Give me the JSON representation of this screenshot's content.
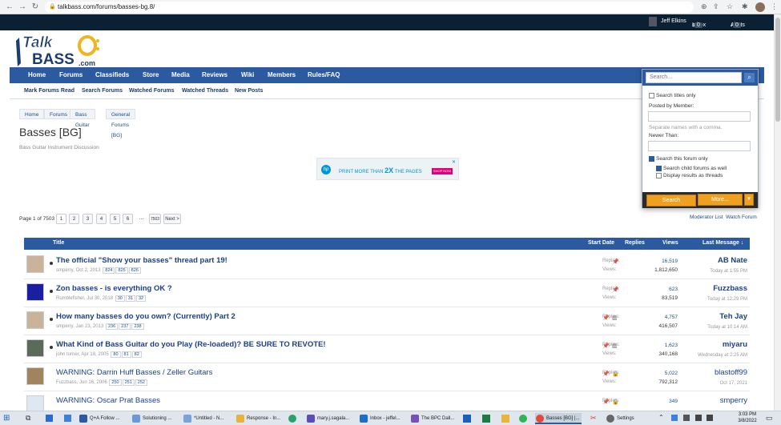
{
  "browser": {
    "url": "talkbass.com/forums/basses-bg.8/"
  },
  "userbar": {
    "user_name": "Jeff Elkins",
    "inbox_label": "Inbox",
    "inbox_count": "0",
    "alerts_label": "Alerts",
    "alerts_count": "0"
  },
  "logo": {
    "line1": "Talk",
    "line2": "BASS",
    "suffix": ".com"
  },
  "main_nav": [
    "Home",
    "Forums",
    "Classifieds",
    "Store",
    "Media",
    "Reviews",
    "Wiki",
    "Members",
    "Rules/FAQ"
  ],
  "sub_nav": [
    "Mark Forums Read",
    "Search Forums",
    "Watched Forums",
    "Watched Threads",
    "New Posts"
  ],
  "breadcrumb": [
    "Home",
    "Forums",
    "Bass Guitar",
    "General Forums [BG]"
  ],
  "page": {
    "title": "Basses [BG]",
    "subtitle": "Bass Guitar Instrument Discussion"
  },
  "ad": {
    "text_pre": "PRINT MORE THAN ",
    "text_big": "2X",
    "text_post": " THE PAGES",
    "button": "SHOP NOW"
  },
  "pager": {
    "label": "Page 1 of 7503",
    "pages": [
      "1",
      "2",
      "3",
      "4",
      "5",
      "6"
    ],
    "ellipsis": "…",
    "last": "7503",
    "next": "Next >"
  },
  "search_panel": {
    "placeholder": "Search...",
    "titles_only": "Search titles only",
    "posted_by": "Posted by Member:",
    "names_hint": "Separate names with a comma.",
    "newer_than": "Newer Than:",
    "this_forum_only": "Search this forum only",
    "child_forums": "Search child forums as well",
    "as_threads": "Display results as threads",
    "search_button": "Search",
    "more_button": "More..."
  },
  "mod_links": {
    "moderator_list": "Moderator List",
    "watch_forum": "Watch Forum"
  },
  "table": {
    "headers": {
      "title": "Title",
      "start_date": "Start Date",
      "replies": "Replies",
      "views": "Views",
      "last_message": "Last Message ↓"
    },
    "replies_label": "Replies:",
    "views_label": "Views:",
    "rows": [
      {
        "title": "The official \"Show your basses\" thread part 19!",
        "author": "smperry",
        "date": "Oct 2, 2013",
        "pages": [
          "824",
          "825",
          "826"
        ],
        "replies": "16,519",
        "views": "1,812,650",
        "last_user": "AB Nate",
        "last_time": "Today at 1:55 PM"
      },
      {
        "title": "Zon basses - is everything OK ?",
        "author": "Rumblefisher",
        "date": "Jul 30, 2018",
        "pages": [
          "30",
          "31",
          "32"
        ],
        "replies": "623",
        "views": "83,519",
        "last_user": "Fuzzbass",
        "last_time": "Today at 12:29 PM"
      },
      {
        "title": "How many basses do you own? (Currently) Part 2",
        "author": "smperry",
        "date": "Jan 23, 2013",
        "pages": [
          "236",
          "237",
          "238"
        ],
        "replies": "4,757",
        "views": "416,507",
        "last_user": "Teh Jay",
        "last_time": "Today at 10:14 AM"
      },
      {
        "title": "What Kind of Bass Guitar do you Play (Re-loaded)? BE SURE TO REVOTE!",
        "author": "john turner",
        "date": "Apr 18, 2005",
        "pages": [
          "80",
          "81",
          "82"
        ],
        "replies": "1,623",
        "views": "340,168",
        "last_user": "miyaru",
        "last_time": "Wednesday at 2:25 AM"
      },
      {
        "title": "WARNING: Darrin Huff Basses / Zeller Guitars",
        "author": "Fuzzbass",
        "date": "Jun 16, 2006",
        "pages": [
          "250",
          "251",
          "252"
        ],
        "replies": "5,022",
        "views": "792,312",
        "last_user": "blastoff99",
        "last_time": "Oct 17, 2021"
      },
      {
        "title": "WARNING: Oscar Prat Basses",
        "author": "",
        "date": "",
        "pages": [],
        "replies": "349",
        "views": "",
        "last_user": "smperry",
        "last_time": ""
      }
    ]
  },
  "taskbar": {
    "items": [
      "Q+A Follow ...",
      "Solutioning ...",
      "*Untitled - N...",
      "Response - In...",
      "mary.j.sagala...",
      "Inbox - jeffel...",
      "The BPC Dall...",
      "Basses [BG] |...",
      "Settings"
    ],
    "time": "3:03 PM",
    "date": "3/8/2022"
  },
  "colors": {
    "nav_blue": "#2b5aa0",
    "dark_bar": "#0b2033",
    "orange": "#f0a020"
  }
}
